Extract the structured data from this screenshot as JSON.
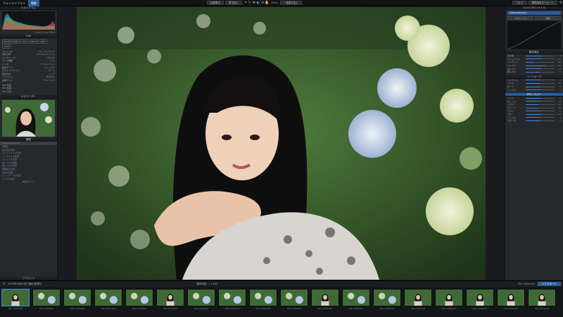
{
  "topbar": {
    "tab_library": "フォトライブラリ",
    "tab_develop": "現像",
    "btn_compare": "比較表示",
    "btn_output": "書き出し",
    "btn_export": "一括書き出し",
    "btn_help": "ヘルプ",
    "btn_settings": "環境設定をリセット",
    "zoom": "100%"
  },
  "left": {
    "histogram_title": "ヒストグラム",
    "hist_readout": "R 255 G 255 B 255",
    "exif_title": "Exif",
    "exif_badges": [
      "ISO 400",
      "1/250",
      "f/2.8",
      "85mm",
      "RAW",
      "+0.3"
    ],
    "meta_rows": [
      {
        "k": "ファイル名",
        "v": "DSF_10174.RAF"
      },
      {
        "k": "撮影日時",
        "v": "2023/06/18 14:32"
      },
      {
        "k": "カメラメーカー",
        "v": "FUJIFILM"
      },
      {
        "k": "カメラ機種",
        "v": "X-H2"
      },
      {
        "k": "レンズ",
        "v": "XF56mm F1.2"
      },
      {
        "k": "露出モード",
        "v": "マニュアル"
      },
      {
        "k": "ホワイトバランス",
        "v": "オート"
      },
      {
        "k": "測光方式",
        "v": "マルチ"
      },
      {
        "k": "フラッシュ",
        "v": "発光禁止"
      },
      {
        "k": "画像サイズ",
        "v": "7728×5152"
      }
    ],
    "gps_rows": [
      {
        "k": "GPS 緯度",
        "v": ""
      },
      {
        "k": "GPS 経度",
        "v": ""
      },
      {
        "k": "GPS 高度",
        "v": ""
      }
    ],
    "navigator_title": "ナビゲーター",
    "presets_title": "履歴",
    "history_items": [
      "Advanced Preset",
      "初期化",
      "露光量の変更",
      "コントラストの変更",
      "ハイライトの変更",
      "シャドウの変更",
      "白レベルの変更",
      "黒レベルの変更",
      "明瞭度の変更",
      "彩度の変更",
      "トーンカーブの変更",
      "マスクの追加"
    ],
    "history_footer": "履歴をクリア",
    "bottom_label": "プリセット"
  },
  "right": {
    "profile_title": "カメラプロファイル",
    "profile_value": "Adobe Standard",
    "profile_btns": [
      "プロファイル",
      "適用"
    ],
    "basic_title": "基本補正",
    "basic_sliders": [
      {
        "lbl": "露光量",
        "val": "+0.30",
        "pct": 0.56
      },
      {
        "lbl": "コントラスト",
        "val": "+12",
        "pct": 0.56
      },
      {
        "lbl": "ハイライト",
        "val": "-45",
        "pct": 0.28
      },
      {
        "lbl": "シャドウ",
        "val": "+38",
        "pct": 0.69
      },
      {
        "lbl": "白レベル",
        "val": "+8",
        "pct": 0.54
      },
      {
        "lbl": "黒レベル",
        "val": "-6",
        "pct": 0.47
      }
    ],
    "tone_title": "トーンカーブ",
    "tone_sliders": [
      {
        "lbl": "ハイライト",
        "val": "0",
        "pct": 0.5
      },
      {
        "lbl": "ライト",
        "val": "+5",
        "pct": 0.52
      },
      {
        "lbl": "ダーク",
        "val": "-4",
        "pct": 0.48
      },
      {
        "lbl": "シャドウ",
        "val": "0",
        "pct": 0.5
      }
    ],
    "hsl_title": "HSL / カラー",
    "hsl_sliders": [
      {
        "lbl": "レッド",
        "val": "0",
        "pct": 0.5
      },
      {
        "lbl": "オレンジ",
        "val": "+6",
        "pct": 0.53
      },
      {
        "lbl": "イエロー",
        "val": "-10",
        "pct": 0.45
      },
      {
        "lbl": "グリーン",
        "val": "-18",
        "pct": 0.41
      },
      {
        "lbl": "アクア",
        "val": "0",
        "pct": 0.5
      },
      {
        "lbl": "ブルー",
        "val": "+14",
        "pct": 0.57
      },
      {
        "lbl": "パープル",
        "val": "0",
        "pct": 0.5
      },
      {
        "lbl": "マゼンタ",
        "val": "0",
        "pct": 0.5
      }
    ]
  },
  "filmstrip": {
    "folder": "2023年06月18日 撮影/紫陽花",
    "count": "選択枚数：1 / 250",
    "btn_collection": "File Collection",
    "btn_export": "エクスポート",
    "thumbs": [
      "DSF_10174.RAF",
      "DSF_10175.RAF",
      "DSF_10176.RAF",
      "DSF_10177.RAF",
      "DSF_10178.RAF",
      "DSF_10179.RAF",
      "DSF_10180.RAF",
      "DSF_10181.RAF",
      "DSF_10182.RAF",
      "DSF_10183.RAF",
      "DSF_10184.RAF",
      "DSF_10185.RAF",
      "DSF_10186.RAF",
      "DSF_10187.RAF",
      "DSF_10188.RAF",
      "DSF_10189.RAF",
      "DSF_10190.RAF",
      "DSF_10191.RAF"
    ]
  },
  "colors": {
    "accent": "#2b5c9e",
    "highlight": "#3d8ae0",
    "panel": "#26282c",
    "bg": "#1d1f22"
  }
}
